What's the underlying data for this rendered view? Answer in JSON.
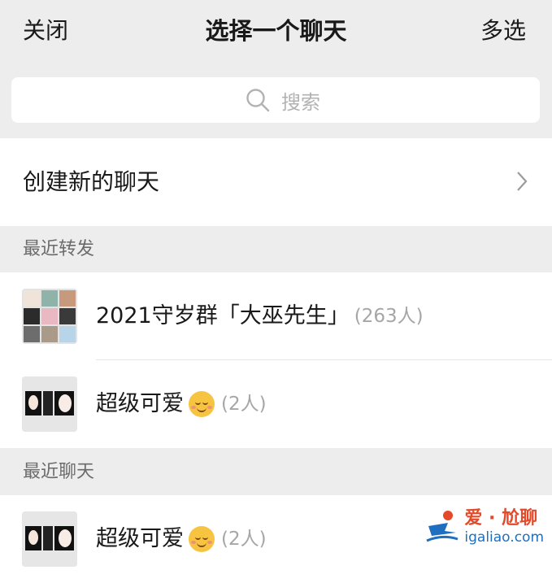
{
  "header": {
    "close_label": "关闭",
    "title": "选择一个聊天",
    "multi_select_label": "多选"
  },
  "search": {
    "placeholder": "搜索",
    "icon": "search-icon"
  },
  "create_chat": {
    "label": "创建新的聊天",
    "icon": "chevron-right-icon"
  },
  "sections": {
    "recent_forwards": "最近转发",
    "recent_chats": "最近聊天"
  },
  "recent_forwards": [
    {
      "name": "2021守岁群「大巫先生」",
      "count": "(263人)",
      "emoji": ""
    },
    {
      "name": "超级可爱",
      "count": "(2人)",
      "emoji": "smiling-face-icon"
    }
  ],
  "recent_chats": [
    {
      "name": "超级可爱",
      "count": "(2人)",
      "emoji": "smiling-face-icon"
    }
  ],
  "watermark": {
    "line1": "爱 · 尬聊",
    "line2": "igaliao.com"
  },
  "colors": {
    "background": "#ededed",
    "text": "#191919",
    "secondary": "#a6a6a6",
    "watermark_red": "#e34a2a",
    "watermark_blue": "#1f6fc1"
  }
}
